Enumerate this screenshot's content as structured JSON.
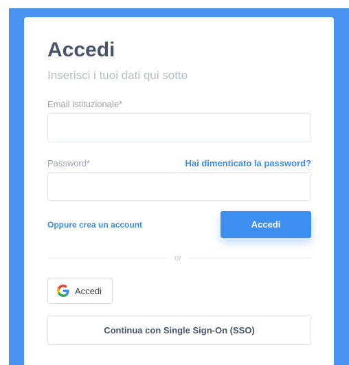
{
  "login": {
    "title": "Accedi",
    "subtitle": "Inserisci i tuoi dati qui sotto",
    "email_label": "Email istituzionale*",
    "email_value": "",
    "password_label": "Password*",
    "password_value": "",
    "forgot_password": "Hai dimenticato la password?",
    "create_account": "Oppure crea un account",
    "submit_label": "Accedi",
    "divider_text": "or",
    "google_label": "Accedi",
    "google_icon": "google-g-icon",
    "sso_label": "Continua con Single Sign-On (SSO)"
  },
  "colors": {
    "background": "#4a93f0",
    "accent": "#3e8ef0",
    "link": "#3a8ce6",
    "title": "#4a5468"
  }
}
